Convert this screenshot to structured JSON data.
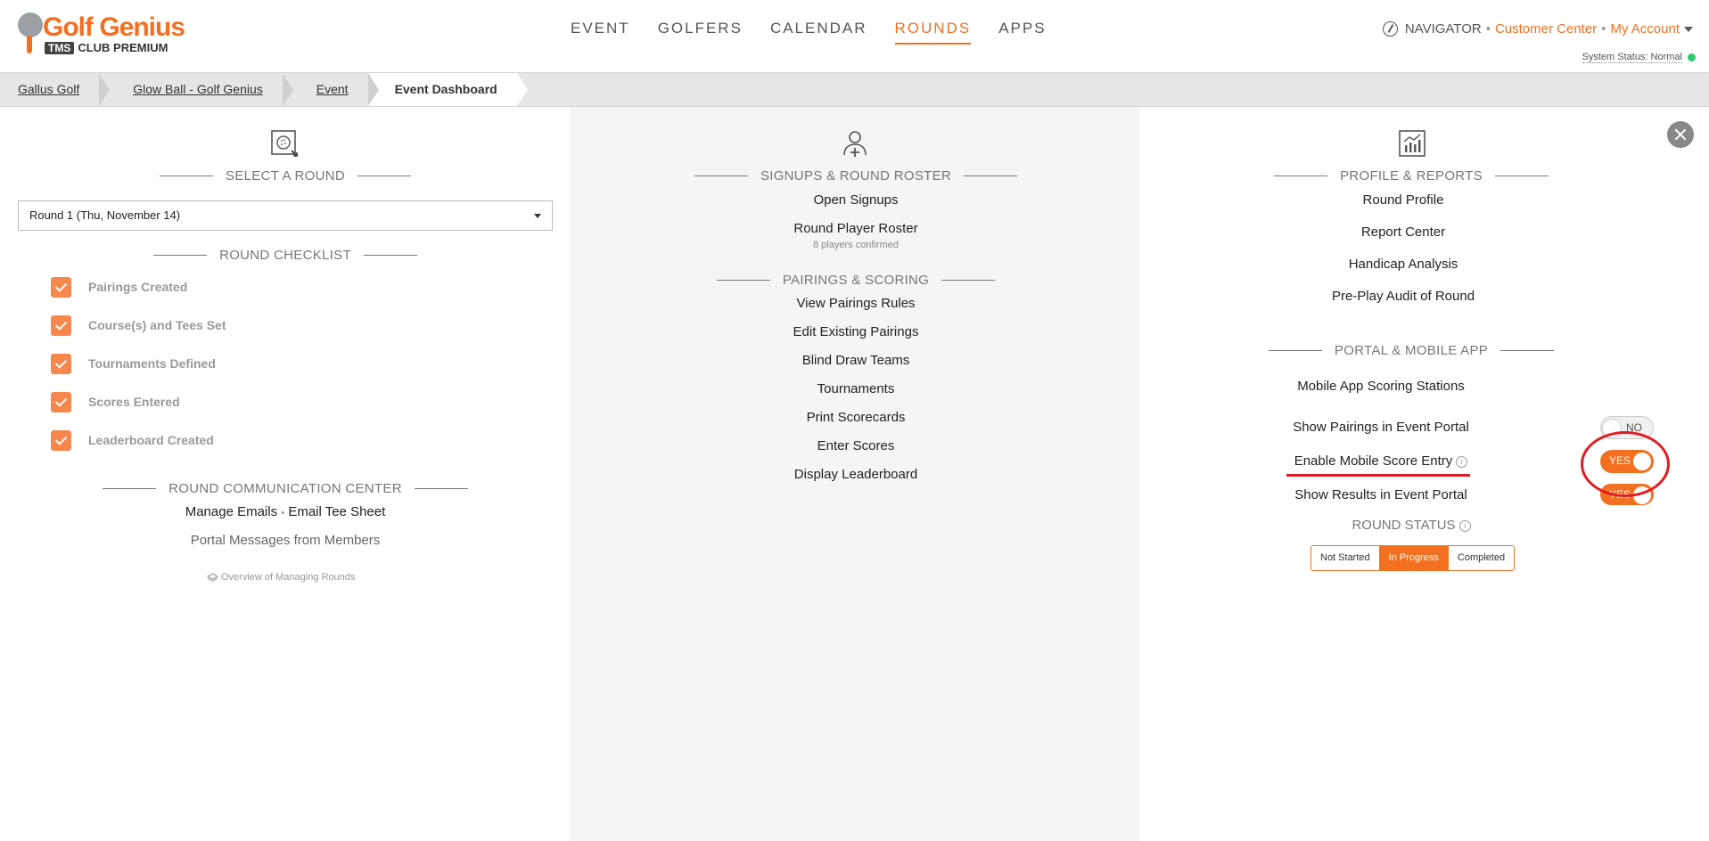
{
  "brand": {
    "name": "Golf Genius",
    "badge": "TMS",
    "tier": "CLUB PREMIUM"
  },
  "nav": [
    "EVENT",
    "GOLFERS",
    "CALENDAR",
    "ROUNDS",
    "APPS"
  ],
  "nav_active": "ROUNDS",
  "topbar": {
    "navigator": "NAVIGATOR",
    "customer_center": "Customer Center",
    "my_account": "My Account",
    "system_status": "System Status: Normal",
    "dot": "•"
  },
  "breadcrumb": [
    "Gallus Golf",
    "Glow Ball - Golf Genius",
    "Event",
    "Event Dashboard"
  ],
  "left": {
    "select_header": "SELECT A ROUND",
    "round_select": "Round 1 (Thu, November 14)",
    "checklist_header": "ROUND CHECKLIST",
    "checklist": [
      "Pairings Created",
      "Course(s) and Tees Set",
      "Tournaments Defined",
      "Scores Entered",
      "Leaderboard Created"
    ],
    "comm_header": "ROUND COMMUNICATION CENTER",
    "manage_emails": "Manage Emails",
    "email_tee_sheet": "Email Tee Sheet",
    "bullet": "•",
    "portal_messages": "Portal Messages from Members",
    "overview": "Overview of Managing Rounds"
  },
  "middle": {
    "signups_header": "SIGNUPS & ROUND ROSTER",
    "open_signups": "Open Signups",
    "round_player_roster": "Round Player Roster",
    "players_confirmed": "8 players confirmed",
    "pairings_header": "PAIRINGS & SCORING",
    "pairing_links": [
      "View Pairings Rules",
      "Edit Existing Pairings",
      "Blind Draw Teams",
      "Tournaments",
      "Print Scorecards",
      "Enter Scores",
      "Display Leaderboard"
    ]
  },
  "right": {
    "profile_header": "PROFILE & REPORTS",
    "profile_links": [
      "Round Profile",
      "Report Center",
      "Handicap Analysis",
      "Pre-Play Audit of Round"
    ],
    "portal_header": "PORTAL & MOBILE APP",
    "mobile_scoring": "Mobile App Scoring Stations",
    "toggles": [
      {
        "label": "Show Pairings in Event Portal",
        "value": "NO"
      },
      {
        "label": "Enable Mobile Score Entry",
        "value": "YES"
      },
      {
        "label": "Show Results in Event Portal",
        "value": "YES"
      }
    ],
    "round_status_label": "ROUND STATUS",
    "status_options": [
      "Not Started",
      "In Progress",
      "Completed"
    ],
    "status_selected": "In Progress",
    "info_glyph": "i"
  },
  "colors": {
    "accent": "#f37021",
    "annotation": "#e31b23",
    "status_ok": "#2ecc71"
  }
}
